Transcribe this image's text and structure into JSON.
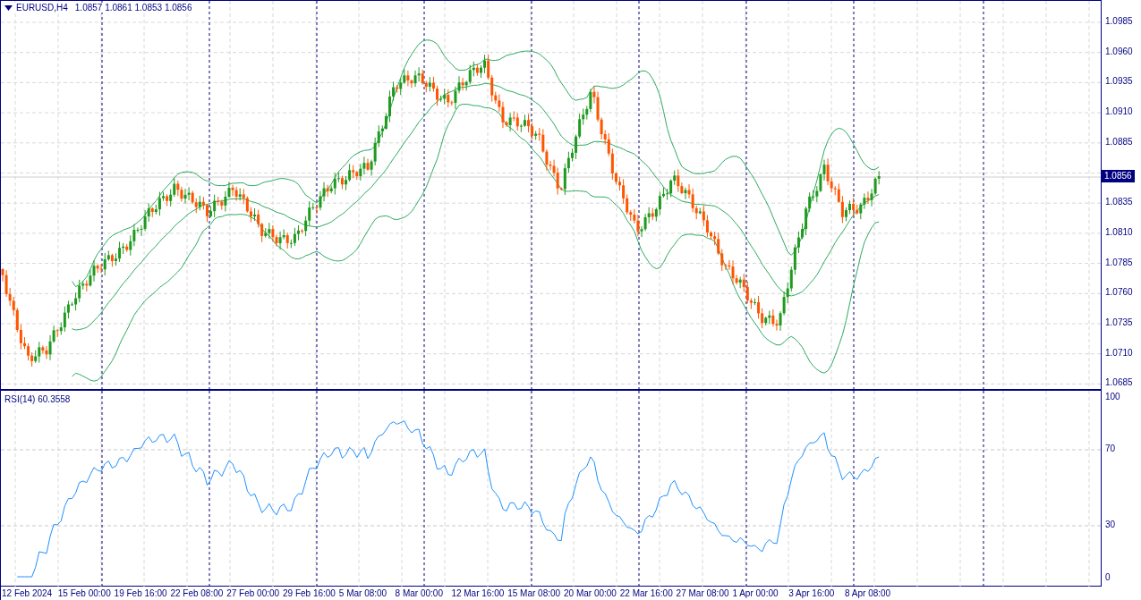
{
  "header": {
    "symbol": "EURUSD,H4",
    "ohlc": [
      "1.0857",
      "1.0861",
      "1.0853",
      "1.0856"
    ]
  },
  "price_axis": {
    "ticks": [
      "1.0985",
      "1.0960",
      "1.0935",
      "1.0910",
      "1.0885",
      "1.0835",
      "1.0810",
      "1.0785",
      "1.0760",
      "1.0735",
      "1.0710",
      "1.0685"
    ],
    "current_price": "1.0856"
  },
  "rsi": {
    "label": "RSI(14) 60.3558",
    "ticks": [
      "100",
      "70",
      "30",
      "0"
    ]
  },
  "time_axis": {
    "labels": [
      "12 Feb 2024",
      "15 Feb 00:00",
      "19 Feb 16:00",
      "22 Feb 08:00",
      "27 Feb 00:00",
      "29 Feb 16:00",
      "5 Mar 08:00",
      "8 Mar 00:00",
      "12 Mar 16:00",
      "15 Mar 08:00",
      "20 Mar 00:00",
      "22 Mar 16:00",
      "27 Mar 08:00",
      "1 Apr 00:00",
      "3 Apr 16:00",
      "8 Apr 08:00"
    ]
  }
}
